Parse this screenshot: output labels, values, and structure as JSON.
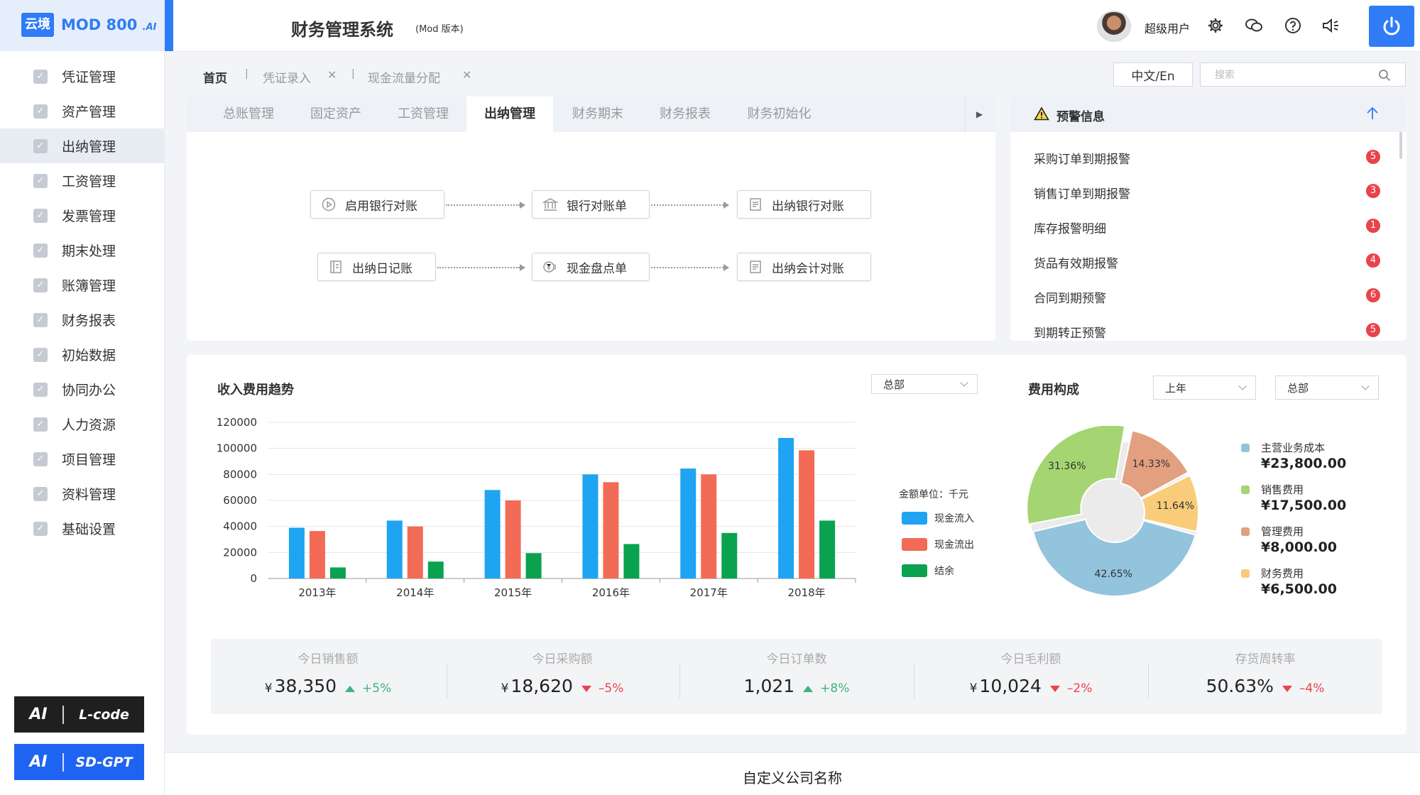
{
  "logo": {
    "badge": "云境",
    "name": "MOD 800",
    "suffix": ".AI"
  },
  "sidebar": {
    "items": [
      {
        "label": "凭证管理"
      },
      {
        "label": "资产管理"
      },
      {
        "label": "出纳管理",
        "active": true
      },
      {
        "label": "工资管理"
      },
      {
        "label": "发票管理"
      },
      {
        "label": "期末处理"
      },
      {
        "label": "账簿管理"
      },
      {
        "label": "财务报表"
      },
      {
        "label": "初始数据"
      },
      {
        "label": "协同办公"
      },
      {
        "label": "人力资源"
      },
      {
        "label": "项目管理"
      },
      {
        "label": "资料管理"
      },
      {
        "label": "基础设置"
      }
    ],
    "ai_buttons": [
      {
        "ai": "AI",
        "name": "L-code",
        "color": "#1f1f1f"
      },
      {
        "ai": "AI",
        "name": "SD-GPT",
        "color": "#1f63f2"
      }
    ]
  },
  "header": {
    "title": "财务管理系统",
    "subtitle": "(Mod 版本)",
    "user": "超级用户",
    "icons": [
      "gear-icon",
      "wechat-icon",
      "help-icon",
      "speaker-icon",
      "power-icon"
    ]
  },
  "breadcrumb": {
    "home": "首页",
    "tabs": [
      {
        "label": "凭证录入"
      },
      {
        "label": "现金流量分配"
      }
    ]
  },
  "language_button": "中文/En",
  "search": {
    "placeholder": "搜索"
  },
  "module_tabs": [
    "总账管理",
    "固定资产",
    "工资管理",
    "出纳管理",
    "财务期末",
    "财务报表",
    "财务初始化"
  ],
  "active_module_tab": "出纳管理",
  "flow": {
    "row1": [
      "启用银行对账",
      "银行对账单",
      "出纳银行对账"
    ],
    "row2": [
      "出纳日记账",
      "现金盘点单",
      "出纳会计对账"
    ]
  },
  "alerts": {
    "title": "预警信息",
    "items": [
      {
        "label": "采购订单到期报警",
        "count": "5"
      },
      {
        "label": "销售订单到期报警",
        "count": "3"
      },
      {
        "label": "库存报警明细",
        "count": "1"
      },
      {
        "label": "货品有效期报警",
        "count": "4"
      },
      {
        "label": "合同到期预警",
        "count": "6"
      },
      {
        "label": "到期转正预警",
        "count": "5"
      }
    ]
  },
  "income_chart": {
    "title": "收入费用趋势",
    "select": "总部",
    "unit_label": "金额单位：千元"
  },
  "cost_chart": {
    "title": "费用构成",
    "select_period": "上年",
    "select_dept": "总部"
  },
  "chart_data": [
    {
      "type": "bar",
      "categories": [
        "2013年",
        "2014年",
        "2015年",
        "2016年",
        "2017年",
        "2018年"
      ],
      "series": [
        {
          "name": "现金流入",
          "color": "#1ea4f2",
          "values": [
            39000,
            44500,
            68000,
            80000,
            84500,
            108000
          ]
        },
        {
          "name": "现金流出",
          "color": "#f26b57",
          "values": [
            36500,
            40000,
            60000,
            74000,
            80000,
            98500
          ]
        },
        {
          "name": "结余",
          "color": "#0aa24f",
          "values": [
            8500,
            13000,
            19500,
            26500,
            35000,
            44500
          ]
        }
      ],
      "ylim": [
        0,
        120000
      ],
      "yticks": [
        "0",
        "20000",
        "40000",
        "60000",
        "80000",
        "100000",
        "120000"
      ]
    },
    {
      "type": "pie",
      "labels": [
        "主营业务成本",
        "销售费用",
        "管理费用",
        "财务费用"
      ],
      "values": [
        23800,
        17500,
        8000,
        6500
      ],
      "percent_labels": [
        "42.65%",
        "31.36%",
        "14.33%",
        "11.64%"
      ],
      "value_labels": [
        "¥23,800.00",
        "¥17,500.00",
        "¥8,000.00",
        "¥6,500.00"
      ],
      "colors": [
        "#93c4de",
        "#a5d572",
        "#e2a080",
        "#f9cc7a"
      ]
    }
  ],
  "stats": [
    {
      "label": "今日销售额",
      "prefix": "¥",
      "value": "38,350",
      "change": "+5%",
      "dir": "up"
    },
    {
      "label": "今日采购额",
      "prefix": "¥",
      "value": "18,620",
      "change": "–5%",
      "dir": "down"
    },
    {
      "label": "今日订单数",
      "prefix": "",
      "value": "1,021",
      "change": "+8%",
      "dir": "up"
    },
    {
      "label": "今日毛利额",
      "prefix": "¥",
      "value": "10,024",
      "change": "–2%",
      "dir": "down"
    },
    {
      "label": "存货周转率",
      "prefix": "",
      "value": "50.63%",
      "change": "–4%",
      "dir": "down"
    }
  ],
  "footer": {
    "company": "自定义公司名称"
  }
}
